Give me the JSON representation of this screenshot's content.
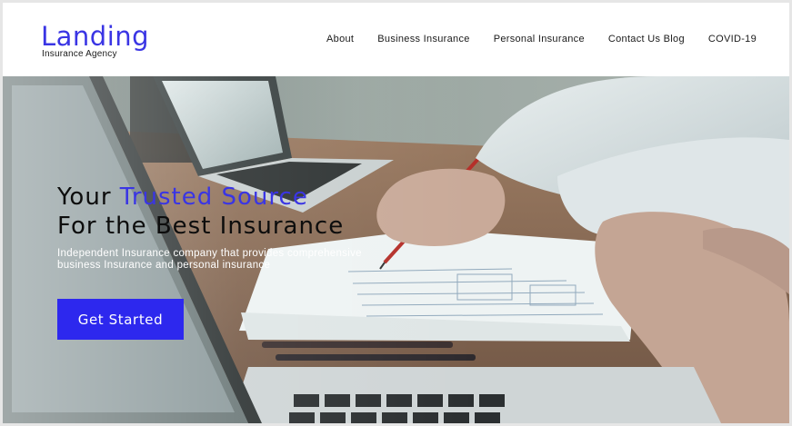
{
  "brand": {
    "title": "Landing",
    "subtitle": "Insurance Agency",
    "accent_color": "#3a35e4"
  },
  "nav": {
    "items": [
      {
        "label": "About"
      },
      {
        "label": "Business Insurance"
      },
      {
        "label": "Personal Insurance"
      },
      {
        "label": "Contact Us Blog"
      },
      {
        "label": "COVID-19"
      }
    ]
  },
  "hero": {
    "headline_part1": "Your ",
    "headline_accent": "Trusted Source",
    "headline_line2": "For the Best Insurance",
    "subtext_line1": "Independent Insurance company that provides comprehensive",
    "subtext_line2": "business Insurance and personal insurance",
    "cta_label": "Get Started",
    "cta_color": "#2d28ee",
    "background_image": "office desk with laptops, hands holding a pencil over paper sheets"
  }
}
